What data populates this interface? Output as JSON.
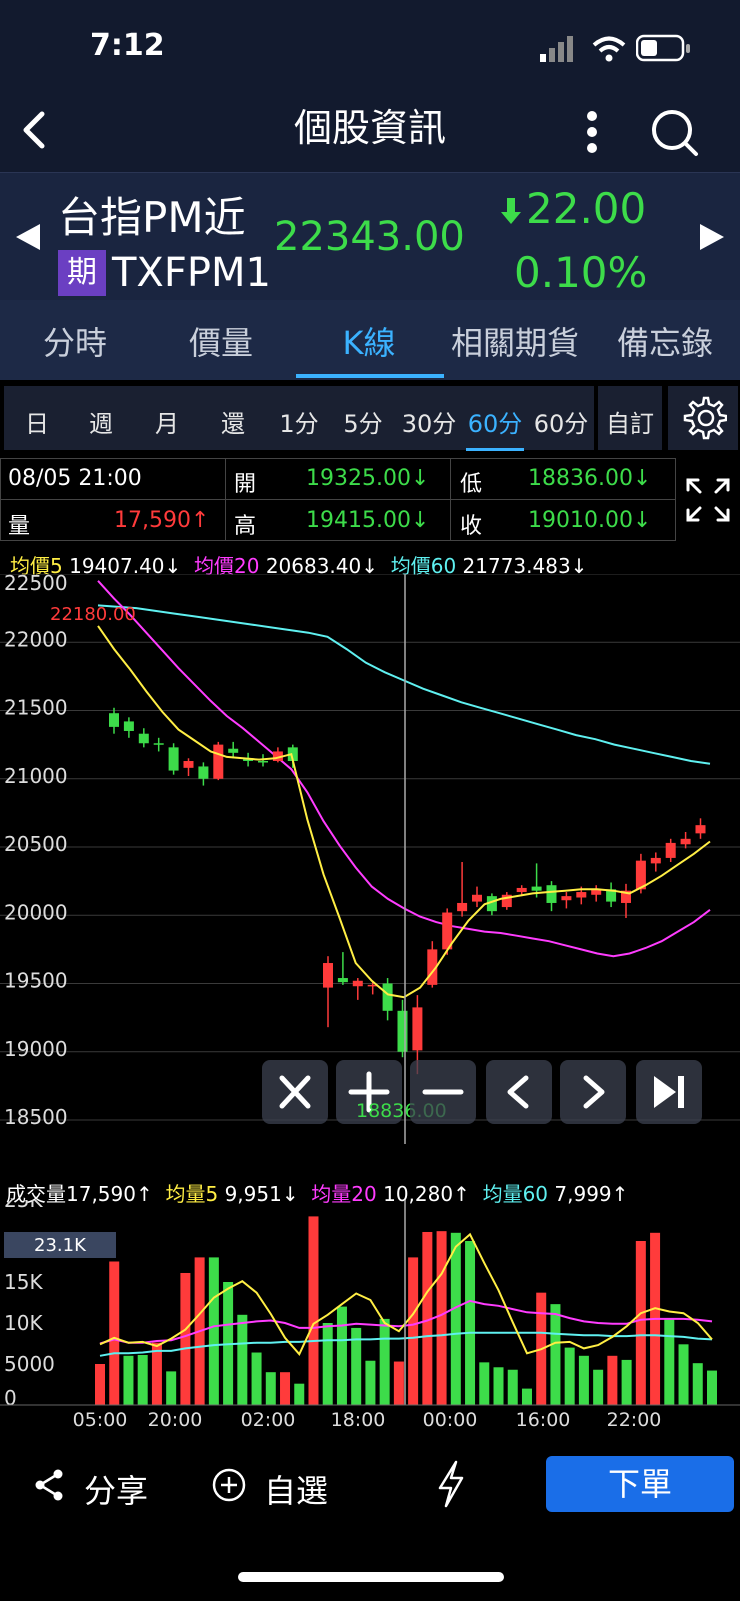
{
  "status": {
    "time": "7:12"
  },
  "nav": {
    "title": "個股資訊"
  },
  "quote": {
    "name": "台指PM近",
    "badge": "期",
    "code": "TXFPM1",
    "price": "22343.00",
    "change": "22.00",
    "change_pct": "0.10%"
  },
  "tabs": [
    "分時",
    "價量",
    "K線",
    "相關期貨",
    "備忘錄"
  ],
  "periods": [
    "日",
    "週",
    "月",
    "還",
    "1分",
    "5分",
    "30分",
    "60分",
    "60分"
  ],
  "period_custom": "自訂",
  "ohlc": {
    "datetime": "08/05 21:00",
    "open_label": "開",
    "open": "19325.00↓",
    "low_label": "低",
    "low": "18836.00↓",
    "vol_label": "量",
    "vol": "17,590↑",
    "high_label": "高",
    "high": "19415.00↓",
    "close_label": "收",
    "close": "19010.00↓"
  },
  "ma_legend": {
    "ma5_label": "均價5",
    "ma5": "19407.40↓",
    "ma20_label": "均價20",
    "ma20": "20683.40↓",
    "ma60_label": "均價60",
    "ma60": "21773.483↓"
  },
  "vol_legend": {
    "vol_label": "成交量",
    "vol": "17,590↑",
    "v5_label": "均量5",
    "v5": "9,951↓",
    "v20_label": "均量20",
    "v20": "10,280↑",
    "v60_label": "均量60",
    "v60": "7,999↑"
  },
  "price_axis": [
    "22500",
    "22000",
    "21500",
    "21000",
    "20500",
    "20000",
    "19500",
    "19000",
    "18500"
  ],
  "vol_axis": [
    "25K",
    "15K",
    "10K",
    "5000",
    "0"
  ],
  "vol_cursor_label": "23.1K",
  "time_axis": [
    "05:00",
    "20:00",
    "02:00",
    "18:00",
    "00:00",
    "16:00",
    "22:00"
  ],
  "annotations": {
    "high_mark": "22180.00",
    "low_mark": "18836.00"
  },
  "bottom": {
    "share": "分享",
    "watch": "自選",
    "order": "下單"
  },
  "colors": {
    "up": "#ff3b3b",
    "down": "#3ddc4a",
    "ma5": "#ffee44",
    "ma20": "#ff3cff",
    "ma60": "#5ff0f0",
    "accent": "#3bb2ff"
  },
  "chart_data": {
    "type": "candlestick",
    "ylim": [
      18500,
      22500
    ],
    "candles": [
      {
        "o": 21480,
        "h": 21520,
        "l": 21330,
        "c": 21380
      },
      {
        "o": 21420,
        "h": 21450,
        "l": 21300,
        "c": 21350
      },
      {
        "o": 21330,
        "h": 21370,
        "l": 21230,
        "c": 21260
      },
      {
        "o": 21260,
        "h": 21300,
        "l": 21200,
        "c": 21250
      },
      {
        "o": 21230,
        "h": 21260,
        "l": 21030,
        "c": 21060
      },
      {
        "o": 21080,
        "h": 21150,
        "l": 21020,
        "c": 21130
      },
      {
        "o": 21090,
        "h": 21120,
        "l": 20950,
        "c": 21000
      },
      {
        "o": 21000,
        "h": 21270,
        "l": 20990,
        "c": 21250
      },
      {
        "o": 21220,
        "h": 21270,
        "l": 21150,
        "c": 21190
      },
      {
        "o": 21150,
        "h": 21190,
        "l": 21090,
        "c": 21130
      },
      {
        "o": 21130,
        "h": 21180,
        "l": 21090,
        "c": 21120
      },
      {
        "o": 21130,
        "h": 21230,
        "l": 21120,
        "c": 21200
      },
      {
        "o": 21230,
        "h": 21250,
        "l": 21080,
        "c": 21130
      },
      {
        "o": 19470,
        "h": 19700,
        "l": 19180,
        "c": 19650
      },
      {
        "o": 19540,
        "h": 19730,
        "l": 19490,
        "c": 19510
      },
      {
        "o": 19480,
        "h": 19540,
        "l": 19380,
        "c": 19520
      },
      {
        "o": 19480,
        "h": 19520,
        "l": 19420,
        "c": 19490
      },
      {
        "o": 19500,
        "h": 19540,
        "l": 19230,
        "c": 19300
      },
      {
        "o": 19300,
        "h": 19380,
        "l": 18960,
        "c": 19000
      },
      {
        "o": 19010,
        "h": 19415,
        "l": 18836,
        "c": 19325
      },
      {
        "o": 19490,
        "h": 19810,
        "l": 19470,
        "c": 19750
      },
      {
        "o": 19750,
        "h": 20050,
        "l": 19710,
        "c": 20020
      },
      {
        "o": 20030,
        "h": 20390,
        "l": 19990,
        "c": 20090
      },
      {
        "o": 20100,
        "h": 20210,
        "l": 20060,
        "c": 20150
      },
      {
        "o": 20140,
        "h": 20160,
        "l": 20000,
        "c": 20030
      },
      {
        "o": 20060,
        "h": 20170,
        "l": 20040,
        "c": 20150
      },
      {
        "o": 20170,
        "h": 20220,
        "l": 20140,
        "c": 20200
      },
      {
        "o": 20210,
        "h": 20380,
        "l": 20130,
        "c": 20180
      },
      {
        "o": 20220,
        "h": 20250,
        "l": 20030,
        "c": 20090
      },
      {
        "o": 20110,
        "h": 20170,
        "l": 20050,
        "c": 20140
      },
      {
        "o": 20130,
        "h": 20210,
        "l": 20080,
        "c": 20170
      },
      {
        "o": 20150,
        "h": 20220,
        "l": 20100,
        "c": 20190
      },
      {
        "o": 20190,
        "h": 20240,
        "l": 20060,
        "c": 20100
      },
      {
        "o": 20090,
        "h": 20230,
        "l": 19980,
        "c": 20180
      },
      {
        "o": 20190,
        "h": 20450,
        "l": 20160,
        "c": 20400
      },
      {
        "o": 20380,
        "h": 20460,
        "l": 20320,
        "c": 20420
      },
      {
        "o": 20420,
        "h": 20560,
        "l": 20390,
        "c": 20530
      },
      {
        "o": 20520,
        "h": 20610,
        "l": 20490,
        "c": 20560
      },
      {
        "o": 20600,
        "h": 20710,
        "l": 20560,
        "c": 20660
      }
    ],
    "ma5": [
      22120,
      21950,
      21800,
      21640,
      21490,
      21360,
      21280,
      21200,
      21160,
      21150,
      21140,
      21150,
      21180,
      20700,
      20300,
      19980,
      19650,
      19520,
      19420,
      19400,
      19470,
      19620,
      19800,
      19960,
      20080,
      20120,
      20140,
      20160,
      20170,
      20180,
      20190,
      20190,
      20180,
      20160,
      20220,
      20290,
      20370,
      20450,
      20540
    ],
    "ma20": [
      22450,
      22320,
      22200,
      22070,
      21940,
      21810,
      21690,
      21570,
      21460,
      21370,
      21270,
      21170,
      21070,
      20900,
      20690,
      20510,
      20350,
      20210,
      20120,
      20050,
      19990,
      19950,
      19920,
      19900,
      19880,
      19870,
      19850,
      19830,
      19810,
      19780,
      19750,
      19720,
      19700,
      19720,
      19760,
      19810,
      19880,
      19950,
      20040
    ],
    "ma60": [
      22270,
      22260,
      22250,
      22230,
      22210,
      22190,
      22170,
      22150,
      22130,
      22110,
      22090,
      22070,
      22040,
      21950,
      21850,
      21780,
      21720,
      21660,
      21610,
      21560,
      21520,
      21480,
      21440,
      21400,
      21360,
      21320,
      21290,
      21250,
      21220,
      21190,
      21160,
      21130,
      21110
    ],
    "volumes": [
      {
        "v": 5000,
        "up": true
      },
      {
        "v": 17500,
        "up": true
      },
      {
        "v": 6000,
        "up": false
      },
      {
        "v": 6100,
        "up": false
      },
      {
        "v": 7600,
        "up": true
      },
      {
        "v": 4100,
        "up": false
      },
      {
        "v": 16100,
        "up": true
      },
      {
        "v": 18000,
        "up": true
      },
      {
        "v": 18000,
        "up": false
      },
      {
        "v": 15000,
        "up": false
      },
      {
        "v": 11000,
        "up": false
      },
      {
        "v": 6400,
        "up": false
      },
      {
        "v": 4000,
        "up": false
      },
      {
        "v": 4000,
        "up": true
      },
      {
        "v": 2600,
        "up": false
      },
      {
        "v": 23000,
        "up": true
      },
      {
        "v": 10000,
        "up": false
      },
      {
        "v": 12000,
        "up": false
      },
      {
        "v": 9400,
        "up": false
      },
      {
        "v": 5400,
        "up": false
      },
      {
        "v": 10500,
        "up": false
      },
      {
        "v": 5300,
        "up": true
      },
      {
        "v": 18000,
        "up": true
      },
      {
        "v": 21100,
        "up": true
      },
      {
        "v": 21200,
        "up": true
      },
      {
        "v": 21000,
        "up": false
      },
      {
        "v": 20000,
        "up": false
      },
      {
        "v": 5200,
        "up": false
      },
      {
        "v": 4600,
        "up": false
      },
      {
        "v": 4300,
        "up": false
      },
      {
        "v": 2000,
        "up": false
      },
      {
        "v": 13700,
        "up": true
      },
      {
        "v": 12300,
        "up": false
      },
      {
        "v": 7000,
        "up": false
      },
      {
        "v": 6000,
        "up": false
      },
      {
        "v": 4300,
        "up": false
      },
      {
        "v": 6000,
        "up": true
      },
      {
        "v": 5500,
        "up": false
      },
      {
        "v": 20000,
        "up": true
      },
      {
        "v": 21000,
        "up": true
      },
      {
        "v": 10600,
        "up": false
      },
      {
        "v": 7400,
        "up": false
      },
      {
        "v": 5100,
        "up": false
      },
      {
        "v": 4200,
        "up": false
      }
    ],
    "vol_ma5": [
      7400,
      8200,
      7600,
      7700,
      7200,
      8100,
      9200,
      11100,
      13100,
      14200,
      15100,
      13700,
      11100,
      8200,
      6200,
      9900,
      11000,
      12300,
      13600,
      12800,
      10000,
      9000,
      11100,
      13800,
      16000,
      19300,
      20800,
      17300,
      14000,
      10100,
      6300,
      6800,
      7600,
      7700,
      6900,
      7300,
      8300,
      9600,
      11200,
      11800,
      11400,
      11200,
      10000,
      8000
    ],
    "vol_ma20": [
      7500,
      8000,
      7600,
      7600,
      7800,
      7900,
      8400,
      9000,
      9600,
      9800,
      10000,
      10200,
      10300,
      10000,
      9400,
      9400,
      9600,
      9700,
      9900,
      9800,
      9700,
      9600,
      9800,
      10300,
      11000,
      11900,
      12700,
      12300,
      12100,
      11700,
      11300,
      11200,
      11100,
      10600,
      10200,
      10000,
      9900,
      9900,
      10400,
      10500,
      10500,
      10500,
      10400,
      10200
    ],
    "vol_ma60": [
      6000,
      6300,
      6300,
      6400,
      6600,
      6600,
      6900,
      7100,
      7300,
      7400,
      7500,
      7600,
      7600,
      7700,
      7700,
      7800,
      7900,
      7900,
      8000,
      8000,
      8100,
      8100,
      8200,
      8400,
      8500,
      8700,
      8800,
      8800,
      8800,
      8800,
      8800,
      8800,
      8700,
      8600,
      8500,
      8500,
      8400,
      8400,
      8500,
      8500,
      8400,
      8300,
      8100,
      8000
    ],
    "vol_ylim": [
      0,
      25000
    ]
  }
}
